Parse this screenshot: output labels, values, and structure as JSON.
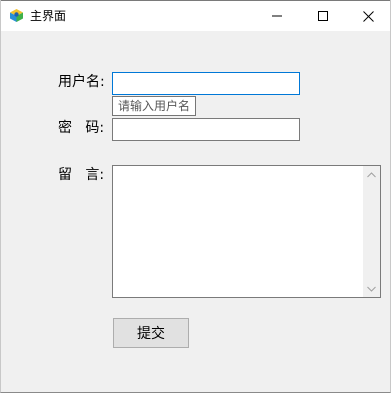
{
  "window": {
    "title": "主界面",
    "icon": "app-cube-icon",
    "controls": [
      "minimize-icon",
      "maximize-icon",
      "close-icon"
    ]
  },
  "form": {
    "username_label": "用户名:",
    "username_value": "",
    "username_tooltip": "请输入用户名",
    "password_label": "密   码:",
    "password_value": "",
    "message_label": "留   言:",
    "message_value": "",
    "submit_label": "提交"
  },
  "colors": {
    "focus_border": "#0078d7",
    "window_bg": "#f0f0f0",
    "button_bg": "#e1e1e1"
  }
}
